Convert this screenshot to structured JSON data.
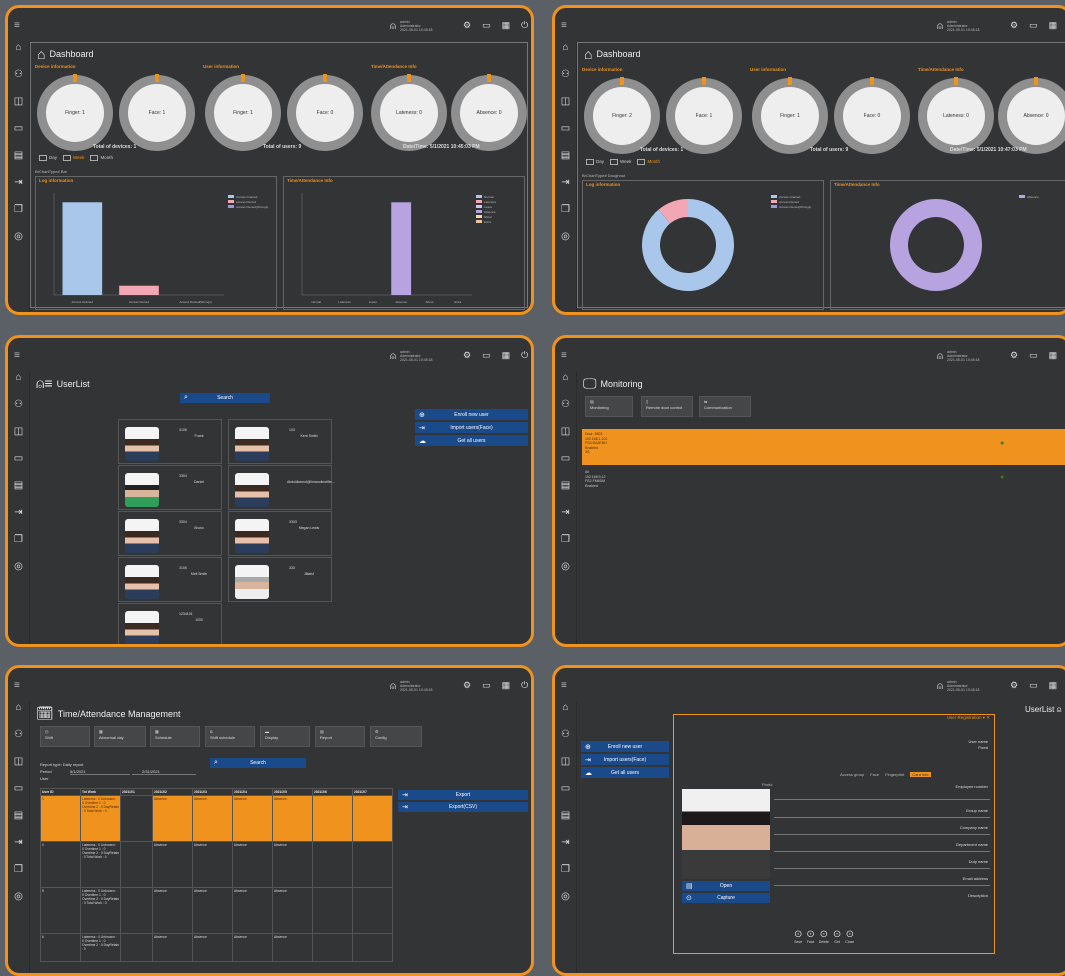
{
  "topbar": {
    "username": "admin",
    "role": "Administrator",
    "datetime": "2021-05-01 10:45:18"
  },
  "dashboard": {
    "title": "Dashboard",
    "sections": [
      "Device information",
      "User information",
      "Time/Attendance Info"
    ],
    "rings": [
      "Finger: 1",
      "Face: 1",
      "Finger: 1",
      "Face: 0",
      "Lateness: 0",
      "Absence: 0"
    ],
    "rings_month": [
      "Finger: 2",
      "Face: 1",
      "Finger: 1",
      "Face: 0",
      "Lateness: 0",
      "Absence: 0"
    ],
    "total_devices": "Total of devices: 1",
    "total_users": "Total of users: 9",
    "datetime_label": "Date/Time: 5/1/2021 10:45:03 PM",
    "datetime_label2": "Date/Time: 5/1/2021 10:47:03 PM",
    "tabs": [
      "Day",
      "Week",
      "Month"
    ],
    "chart_type_bar": "BrChartType# Bar",
    "chart_type_doughnut": "BrChartType# Doughnut",
    "log_info": "Log information",
    "ta_info": "Time/Attendance Info"
  },
  "chart_data": [
    {
      "type": "bar",
      "title": "Log information",
      "categories": [
        "Access Granted",
        "Access Denied",
        "Access Denied(Wrongs)"
      ],
      "values": [
        10,
        1,
        0
      ],
      "ylim": [
        0,
        11
      ],
      "colors": [
        "#a9c7ea",
        "#f3a6b4",
        "#9a9ae0"
      ],
      "legend": "top-right"
    },
    {
      "type": "bar",
      "title": "Time/Attendance Info",
      "categories": [
        "Normal",
        "Lateness",
        "Leave",
        "Absence",
        "Shout",
        "Extra"
      ],
      "values": [
        0,
        0,
        0,
        1,
        0,
        0
      ],
      "ylim": [
        0,
        1.1
      ],
      "colors": [
        "#a9c7ea",
        "#f3a6b4",
        "#d9c0f0",
        "#b6a3e0",
        "#f0e090",
        "#f0c3a0"
      ],
      "legend": "top-right"
    },
    {
      "type": "pie",
      "title": "Log information",
      "categories": [
        "Access Granted",
        "Access Denied",
        "Access Denied(Wrongs)"
      ],
      "values": [
        89,
        11,
        0
      ],
      "colors": [
        "#a9c7ea",
        "#f3a6b4",
        "#9a9ae0"
      ]
    },
    {
      "type": "pie",
      "title": "Time/Attendance Info",
      "categories": [
        "Absence"
      ],
      "values": [
        100
      ],
      "colors": [
        "#b6a3e0"
      ]
    }
  ],
  "userlist": {
    "title": "UserList",
    "search": "Search",
    "actions": [
      "Enroll new user",
      "Import users(Face)",
      "Get all users"
    ],
    "cards": [
      {
        "id": "3106",
        "name": "Frank"
      },
      {
        "id": "103",
        "name": "Kent Smith"
      },
      {
        "id": "3304",
        "name": "Daniel"
      },
      {
        "id": "",
        "name": "Abdoliikamol@ilmanoilnotifie..."
      },
      {
        "id": "3304",
        "name": "Bruno"
      },
      {
        "id": "3303",
        "name": "Megan Lewis"
      },
      {
        "id": "3106",
        "name": "Mell Smith"
      },
      {
        "id": "333",
        "name": "Jittaful"
      },
      {
        "id": "1234101",
        "name": "1000"
      }
    ]
  },
  "monitoring": {
    "title": "Monitoring",
    "buttons": [
      "Monitoring",
      "Remote door control",
      "Communication"
    ],
    "rows": [
      {
        "lines": [
          "Door: 3503",
          "192.168.1.101",
          "FS3-DA2ENH",
          "Enabled",
          "3/1"
        ]
      },
      {
        "lines": [
          "Ali",
          "192.168.9.12",
          "FS2-FM6DM",
          "Enabled"
        ]
      }
    ]
  },
  "ta": {
    "title": "Time/Attendance Management",
    "buttons": [
      "Shift",
      "Abnormal day",
      "Schedule",
      "Shift schedule",
      "Display",
      "Report",
      "Config"
    ],
    "report_type": "Report type: Daily report",
    "period": "Period",
    "start": "5/1/2021",
    "end": "2/31/2021",
    "user": "User",
    "search": "Search",
    "export": "Export",
    "export_csv": "Export(CSV)",
    "headers": [
      "User ID",
      "Tot Work",
      "2021/2/1",
      "2021/2/2",
      "2021/2/3",
      "2021/2/4",
      "2021/2/5",
      "2021/2/6",
      "2021/2/7",
      "2021/2/8"
    ],
    "rows": [
      {
        "id": "1",
        "sum": "Lateness : 0 Unknown : 0 Overtime 1 : 0 Overtime 2 : 0 DayRetain : 0 Total Work : 0",
        "cell": "Absence"
      },
      {
        "id": "4",
        "sum": "Lateness : 0 Unknown : 0 Overtime 1 : 0 Overtime 2 : 0 DayRetain : 0 Total Work : 0",
        "cell": "Absence"
      },
      {
        "id": "5",
        "sum": "Lateness : 0 Unknown : 0 Overtime 1 : 0 Overtime 2 : 0 DayRetain : 0 Total Work : 0",
        "cell": "Absence"
      },
      {
        "id": "6",
        "sum": "Lateness : 0 Unknown : 0 Overtime 1 : 0 Overtime 2 : 0 DayRetain : 0",
        "cell": "Absence"
      }
    ]
  },
  "regist": {
    "title": "User Registration",
    "userlist_label": "UserList",
    "actions": [
      "Enroll new user",
      "Import users(Face)",
      "Get all users"
    ],
    "photo_label": "Photo",
    "open": "Open",
    "capture": "Capture",
    "fields": [
      "User name",
      "Fixed",
      "Employee number",
      "Group name",
      "Company name",
      "Department name",
      "Duty name",
      "Email address",
      "Description"
    ],
    "icons_row": [
      "Access group",
      "Face",
      "Fingerprint",
      "Card info"
    ],
    "bottom": [
      "Save",
      "Face",
      "Delete",
      "Get",
      "Close"
    ]
  }
}
